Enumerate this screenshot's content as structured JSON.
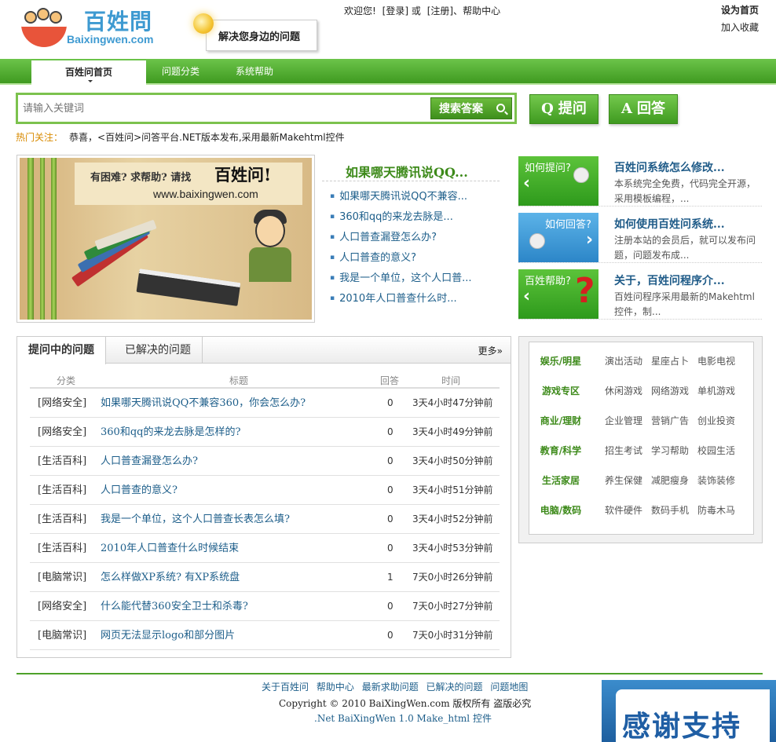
{
  "brand": {
    "logo_cn": "百姓問",
    "logo_en": "Baixingwen.com",
    "slogan": "解决您身边的问题"
  },
  "topbar": {
    "welcome": "欢迎您!",
    "login": "[登录]",
    "or": "或",
    "register": "[注册]、",
    "help": "帮助中心",
    "set_home": "设为首页",
    "bookmark": "加入收藏"
  },
  "nav": {
    "items": [
      {
        "label": "百姓问首页"
      },
      {
        "label": "问题分类"
      },
      {
        "label": "系统帮助"
      }
    ]
  },
  "search": {
    "placeholder": "请输入关键词",
    "button": "搜索答案",
    "ask_letter": "Q",
    "ask": "提问",
    "answer_letter": "A",
    "answer": "回答"
  },
  "hot": {
    "label": "热门关注：",
    "text": "恭喜，<百姓问>问答平台.NET版本发布,采用最新Makehtml控件"
  },
  "banner": {
    "line1": "有困难? 求帮助?   请找",
    "brand": "百姓问!",
    "url": "www.baixingwen.com"
  },
  "headlines": {
    "title": "如果哪天腾讯说QQ...",
    "items": [
      "如果哪天腾讯说QQ不兼容...",
      "360和qq的来龙去脉是...",
      "人口普查漏登怎么办?",
      "人口普查的意义?",
      "我是一个单位，这个人口普...",
      "2010年人口普查什么时..."
    ]
  },
  "features": [
    {
      "img_label": "如何提问?",
      "title": "百姓问系统怎么修改...",
      "desc": "本系统完全免费，代码完全开源，采用模板编程，..."
    },
    {
      "img_label": "如何回答?",
      "title": "如何使用百姓问系统...",
      "desc": "注册本站的会员后，就可以发布问题，问题发布成..."
    },
    {
      "img_label": "百姓帮助?",
      "title": "关于，百姓问程序介...",
      "desc": "百姓问程序采用最新的Makehtml控件，制..."
    }
  ],
  "qa": {
    "tabs": [
      "提问中的问题",
      "已解决的问题"
    ],
    "more": "更多»",
    "columns": [
      "分类",
      "标题",
      "回答",
      "时间"
    ],
    "rows": [
      {
        "cat": "[网络安全]",
        "title": "如果哪天腾讯说QQ不兼容360，你会怎么办?",
        "answers": "0",
        "time": "3天4小时47分钟前"
      },
      {
        "cat": "[网络安全]",
        "title": "360和qq的来龙去脉是怎样的?",
        "answers": "0",
        "time": "3天4小时49分钟前"
      },
      {
        "cat": "[生活百科]",
        "title": "人口普查漏登怎么办?",
        "answers": "0",
        "time": "3天4小时50分钟前"
      },
      {
        "cat": "[生活百科]",
        "title": "人口普查的意义?",
        "answers": "0",
        "time": "3天4小时51分钟前"
      },
      {
        "cat": "[生活百科]",
        "title": "我是一个单位，这个人口普查长表怎么填?",
        "answers": "0",
        "time": "3天4小时52分钟前"
      },
      {
        "cat": "[生活百科]",
        "title": "2010年人口普查什么时候结束",
        "answers": "0",
        "time": "3天4小时53分钟前"
      },
      {
        "cat": "[电脑常识]",
        "title": "怎么样做XP系统?  有XP系统盘",
        "answers": "1",
        "time": "7天0小时26分钟前"
      },
      {
        "cat": "[网络安全]",
        "title": "什么能代替360安全卫士和杀毒?",
        "answers": "0",
        "time": "7天0小时27分钟前"
      },
      {
        "cat": "[电脑常识]",
        "title": "网页无法显示logo和部分图片",
        "answers": "0",
        "time": "7天0小时31分钟前"
      }
    ]
  },
  "categories": [
    {
      "head": "娱乐/明星",
      "subs": [
        "演出活动",
        "星座占卜",
        "电影电视"
      ]
    },
    {
      "head": "游戏专区",
      "subs": [
        "休闲游戏",
        "网络游戏",
        "单机游戏"
      ]
    },
    {
      "head": "商业/理财",
      "subs": [
        "企业管理",
        "营销广告",
        "创业投资"
      ]
    },
    {
      "head": "教育/科学",
      "subs": [
        "招生考试",
        "学习帮助",
        "校园生活"
      ]
    },
    {
      "head": "生活家居",
      "subs": [
        "养生保健",
        "减肥瘦身",
        "装饰装修"
      ]
    },
    {
      "head": "电脑/数码",
      "subs": [
        "软件硬件",
        "数码手机",
        "防毒木马"
      ]
    }
  ],
  "footer": {
    "links": [
      "关于百姓问",
      "帮助中心",
      "最新求助问题",
      "已解决的问题",
      "问题地图"
    ],
    "copyright": "Copyright © 2010 BaiXingWen.com 版权所有 盗版必究",
    "version": ".Net BaiXingWen 1.0 Make_html 控件",
    "thanks": "感谢支持"
  }
}
